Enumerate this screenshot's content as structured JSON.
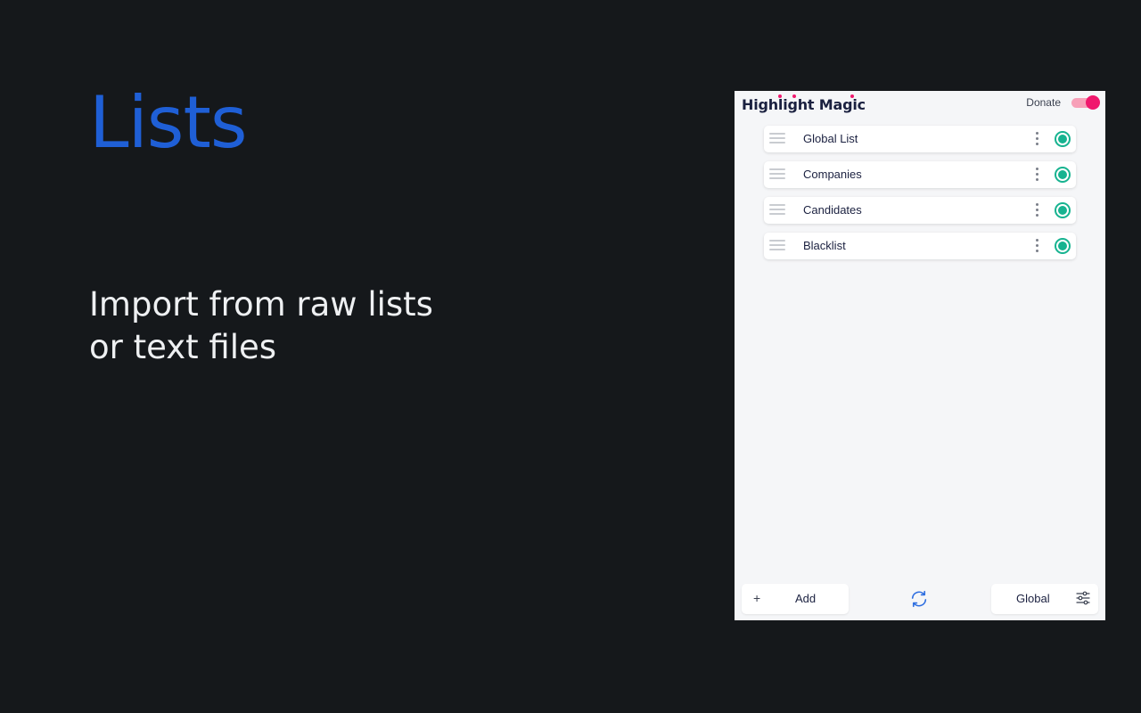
{
  "hero": {
    "title": "Lists",
    "subtitle_line1": "Import from raw lists",
    "subtitle_line2": "or text files"
  },
  "popup": {
    "brand": "Highlight Magic",
    "donate_label": "Donate",
    "master_toggle_on": true,
    "lists": [
      {
        "name": "Global List",
        "enabled": true
      },
      {
        "name": "Companies",
        "enabled": true
      },
      {
        "name": "Candidates",
        "enabled": true
      },
      {
        "name": "Blacklist",
        "enabled": true
      }
    ],
    "footer": {
      "add_icon": "+",
      "add_label": "Add",
      "sync_icon": "sync-icon",
      "scope_label": "Global",
      "settings_icon": "sliders-icon"
    }
  },
  "colors": {
    "background": "#15181b",
    "hero_title": "#1f5fd6",
    "accent_pink": "#f0186d",
    "accent_green": "#17b390",
    "sync_blue": "#2f6fe0"
  }
}
